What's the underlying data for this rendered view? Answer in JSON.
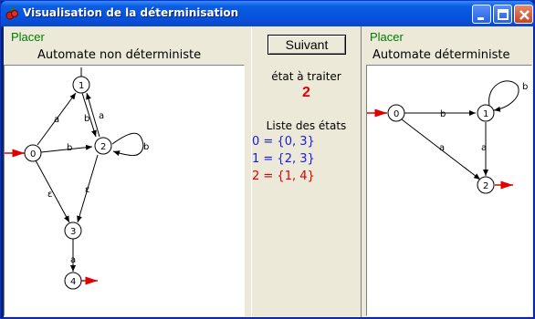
{
  "window": {
    "title": "Visualisation de la déterminisation",
    "colors": {
      "titlebar": "#0a5ee0",
      "close": "#c74421"
    }
  },
  "left": {
    "place_label": "Placer",
    "heading": "Automate non déterministe",
    "nodes": [
      "0",
      "1",
      "2",
      "3",
      "4"
    ],
    "edge_labels": [
      "a",
      "b",
      "a",
      "b",
      "b",
      "ε",
      "ε",
      "a"
    ]
  },
  "middle": {
    "next_button": "Suivant",
    "state_to_process_label": "état à traiter",
    "state_to_process_value": "2",
    "states_list_label": "Liste des états",
    "states": [
      {
        "text": "0 = {0, 3}",
        "color": "#1a1adc"
      },
      {
        "text": "1 = {2, 3}",
        "color": "#1a1adc"
      },
      {
        "text": "2 = {1, 4}",
        "color": "#e00000"
      }
    ]
  },
  "right": {
    "place_label": "Placer",
    "heading": "Automate déterministe",
    "nodes": [
      "0",
      "1",
      "2"
    ],
    "edge_labels": [
      "b",
      "a",
      "a",
      "b"
    ]
  }
}
